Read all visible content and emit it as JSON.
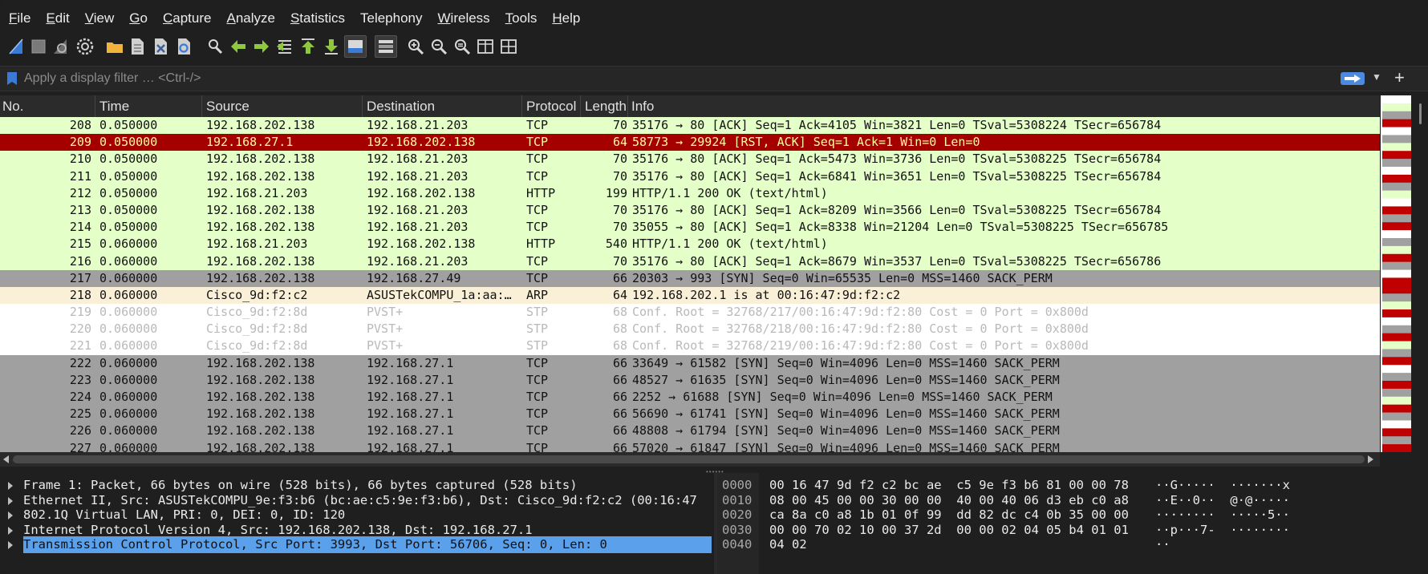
{
  "menu": [
    {
      "ul": "F",
      "rest": "ile"
    },
    {
      "ul": "E",
      "rest": "dit"
    },
    {
      "ul": "V",
      "rest": "iew"
    },
    {
      "ul": "G",
      "rest": "o"
    },
    {
      "ul": "C",
      "rest": "apture"
    },
    {
      "ul": "A",
      "rest": "nalyze"
    },
    {
      "ul": "S",
      "rest": "tatistics"
    },
    {
      "ul": "",
      "rest": "Telephony"
    },
    {
      "ul": "W",
      "rest": "ireless"
    },
    {
      "ul": "T",
      "rest": "ools"
    },
    {
      "ul": "H",
      "rest": "elp"
    }
  ],
  "filter": {
    "placeholder": "Apply a display filter … <Ctrl-/>"
  },
  "columns": {
    "no": "No.",
    "time": "Time",
    "source": "Source",
    "destination": "Destination",
    "protocol": "Protocol",
    "length": "Length",
    "info": "Info"
  },
  "packets": [
    {
      "no": "208",
      "time": "0.050000",
      "src": "192.168.202.138",
      "dst": "192.168.21.203",
      "proto": "TCP",
      "len": "70",
      "info": "35176 → 80 [ACK] Seq=1 Ack=4105 Win=3821 Len=0 TSval=5308224 TSecr=656784",
      "color": "tcp"
    },
    {
      "no": "209",
      "time": "0.050000",
      "src": "192.168.27.1",
      "dst": "192.168.202.138",
      "proto": "TCP",
      "len": "64",
      "info": "58773 → 29924 [RST, ACK] Seq=1 Ack=1 Win=0 Len=0",
      "color": "rst"
    },
    {
      "no": "210",
      "time": "0.050000",
      "src": "192.168.202.138",
      "dst": "192.168.21.203",
      "proto": "TCP",
      "len": "70",
      "info": "35176 → 80 [ACK] Seq=1 Ack=5473 Win=3736 Len=0 TSval=5308225 TSecr=656784",
      "color": "tcp"
    },
    {
      "no": "211",
      "time": "0.050000",
      "src": "192.168.202.138",
      "dst": "192.168.21.203",
      "proto": "TCP",
      "len": "70",
      "info": "35176 → 80 [ACK] Seq=1 Ack=6841 Win=3651 Len=0 TSval=5308225 TSecr=656784",
      "color": "tcp"
    },
    {
      "no": "212",
      "time": "0.050000",
      "src": "192.168.21.203",
      "dst": "192.168.202.138",
      "proto": "HTTP",
      "len": "199",
      "info": "HTTP/1.1 200 OK  (text/html)",
      "color": "http"
    },
    {
      "no": "213",
      "time": "0.050000",
      "src": "192.168.202.138",
      "dst": "192.168.21.203",
      "proto": "TCP",
      "len": "70",
      "info": "35176 → 80 [ACK] Seq=1 Ack=8209 Win=3566 Len=0 TSval=5308225 TSecr=656784",
      "color": "tcp"
    },
    {
      "no": "214",
      "time": "0.050000",
      "src": "192.168.202.138",
      "dst": "192.168.21.203",
      "proto": "TCP",
      "len": "70",
      "info": "35055 → 80 [ACK] Seq=1 Ack=8338 Win=21204 Len=0 TSval=5308225 TSecr=656785",
      "color": "tcp"
    },
    {
      "no": "215",
      "time": "0.060000",
      "src": "192.168.21.203",
      "dst": "192.168.202.138",
      "proto": "HTTP",
      "len": "540",
      "info": "HTTP/1.1 200 OK  (text/html)",
      "color": "http"
    },
    {
      "no": "216",
      "time": "0.060000",
      "src": "192.168.202.138",
      "dst": "192.168.21.203",
      "proto": "TCP",
      "len": "70",
      "info": "35176 → 80 [ACK] Seq=1 Ack=8679 Win=3537 Len=0 TSval=5308225 TSecr=656786",
      "color": "tcp"
    },
    {
      "no": "217",
      "time": "0.060000",
      "src": "192.168.202.138",
      "dst": "192.168.27.49",
      "proto": "TCP",
      "len": "66",
      "info": "20303 → 993 [SYN] Seq=0 Win=65535 Len=0 MSS=1460 SACK_PERM",
      "color": "syn"
    },
    {
      "no": "218",
      "time": "0.060000",
      "src": "Cisco_9d:f2:c2",
      "dst": "ASUSTekCOMPU_1a:aa:…",
      "proto": "ARP",
      "len": "64",
      "info": "192.168.202.1 is at 00:16:47:9d:f2:c2",
      "color": "arp"
    },
    {
      "no": "219",
      "time": "0.060000",
      "src": "Cisco_9d:f2:8d",
      "dst": "PVST+",
      "proto": "STP",
      "len": "68",
      "info": "Conf. Root = 32768/217/00:16:47:9d:f2:80  Cost = 0  Port = 0x800d",
      "color": "stp"
    },
    {
      "no": "220",
      "time": "0.060000",
      "src": "Cisco_9d:f2:8d",
      "dst": "PVST+",
      "proto": "STP",
      "len": "68",
      "info": "Conf. Root = 32768/218/00:16:47:9d:f2:80  Cost = 0  Port = 0x800d",
      "color": "stp"
    },
    {
      "no": "221",
      "time": "0.060000",
      "src": "Cisco_9d:f2:8d",
      "dst": "PVST+",
      "proto": "STP",
      "len": "68",
      "info": "Conf. Root = 32768/219/00:16:47:9d:f2:80  Cost = 0  Port = 0x800d",
      "color": "stp"
    },
    {
      "no": "222",
      "time": "0.060000",
      "src": "192.168.202.138",
      "dst": "192.168.27.1",
      "proto": "TCP",
      "len": "66",
      "info": "33649 → 61582 [SYN] Seq=0 Win=4096 Len=0 MSS=1460 SACK_PERM",
      "color": "syn"
    },
    {
      "no": "223",
      "time": "0.060000",
      "src": "192.168.202.138",
      "dst": "192.168.27.1",
      "proto": "TCP",
      "len": "66",
      "info": "48527 → 61635 [SYN] Seq=0 Win=4096 Len=0 MSS=1460 SACK_PERM",
      "color": "syn"
    },
    {
      "no": "224",
      "time": "0.060000",
      "src": "192.168.202.138",
      "dst": "192.168.27.1",
      "proto": "TCP",
      "len": "66",
      "info": "2252 → 61688 [SYN] Seq=0 Win=4096 Len=0 MSS=1460 SACK_PERM",
      "color": "syn"
    },
    {
      "no": "225",
      "time": "0.060000",
      "src": "192.168.202.138",
      "dst": "192.168.27.1",
      "proto": "TCP",
      "len": "66",
      "info": "56690 → 61741 [SYN] Seq=0 Win=4096 Len=0 MSS=1460 SACK_PERM",
      "color": "syn"
    },
    {
      "no": "226",
      "time": "0.060000",
      "src": "192.168.202.138",
      "dst": "192.168.27.1",
      "proto": "TCP",
      "len": "66",
      "info": "48808 → 61794 [SYN] Seq=0 Win=4096 Len=0 MSS=1460 SACK_PERM",
      "color": "syn"
    },
    {
      "no": "227",
      "time": "0.060000",
      "src": "192.168.202.138",
      "dst": "192.168.27.1",
      "proto": "TCP",
      "len": "66",
      "info": "57020 → 61847 [SYN] Seq=0 Win=4096 Len=0 MSS=1460 SACK_PERM",
      "color": "syn"
    }
  ],
  "details": [
    {
      "text": "Frame 1: Packet, 66 bytes on wire (528 bits), 66 bytes captured (528 bits)",
      "selected": false
    },
    {
      "text": "Ethernet II, Src: ASUSTekCOMPU_9e:f3:b6 (bc:ae:c5:9e:f3:b6), Dst: Cisco_9d:f2:c2 (00:16:47",
      "selected": false
    },
    {
      "text": "802.1Q Virtual LAN, PRI: 0, DEI: 0, ID: 120",
      "selected": false
    },
    {
      "text": "Internet Protocol Version 4, Src: 192.168.202.138, Dst: 192.168.27.1",
      "selected": false
    },
    {
      "text": "Transmission Control Protocol, Src Port: 3993, Dst Port: 56706, Seq: 0, Len: 0",
      "selected": true
    }
  ],
  "bytes": [
    {
      "offset": "0000",
      "hex": "00 16 47 9d f2 c2 bc ae  c5 9e f3 b6 81 00 00 78",
      "ascii": "··G·····  ·······x"
    },
    {
      "offset": "0010",
      "hex": "08 00 45 00 00 30 00 00  40 00 40 06 d3 eb c0 a8",
      "ascii": "··E··0··  @·@·····"
    },
    {
      "offset": "0020",
      "hex": "ca 8a c0 a8 1b 01 0f 99  dd 82 dc c4 0b 35 00 00",
      "ascii": "········  ·····5··"
    },
    {
      "offset": "0030",
      "hex": "00 00 70 02 10 00 37 2d  00 00 02 04 05 b4 01 01",
      "ascii": "··p···7-  ········"
    },
    {
      "offset": "0040",
      "hex": "04 02",
      "ascii": "··"
    }
  ],
  "colors": {
    "tcp": "#e4ffc7",
    "rst": "#a40000",
    "syn": "#a0a0a0",
    "arp": "#faf0d7",
    "stp": "#ffffff",
    "selected": "#5ba0ea",
    "accent": "#3b7bd8"
  },
  "minimap": [
    "#ffffff",
    "#e4ffc7",
    "#a0a0a0",
    "#c00000",
    "#ffffff",
    "#a0a0a0",
    "#e4ffc7",
    "#c00000",
    "#a0a0a0",
    "#ffffff",
    "#c00000",
    "#a0a0a0",
    "#e4ffc7",
    "#ffffff",
    "#c00000",
    "#a0a0a0",
    "#c00000",
    "#ffffff",
    "#a0a0a0",
    "#e4ffc7",
    "#c00000",
    "#a0a0a0",
    "#ffffff",
    "#c00000",
    "#c00000",
    "#a0a0a0",
    "#e4ffc7",
    "#c00000",
    "#ffffff",
    "#a0a0a0",
    "#c00000",
    "#e4ffc7",
    "#a0a0a0",
    "#c00000",
    "#ffffff",
    "#a0a0a0",
    "#c00000",
    "#a0a0a0",
    "#e4ffc7",
    "#c00000",
    "#a0a0a0",
    "#ffffff",
    "#c00000",
    "#a0a0a0",
    "#c00000"
  ],
  "toolbar_icons": [
    "shark-fin-start-icon",
    "stop-square-icon",
    "restart-fin-icon",
    "capture-options-gear-icon",
    "open-folder-icon",
    "save-file-icon",
    "close-file-icon",
    "reload-file-icon",
    "find-packet-icon",
    "go-back-arrow-icon",
    "go-forward-arrow-icon",
    "go-to-packet-icon",
    "go-first-packet-icon",
    "go-last-packet-icon",
    "auto-scroll-icon",
    "colorize-icon",
    "zoom-in-icon",
    "zoom-out-icon",
    "zoom-reset-icon",
    "resize-columns-icon",
    "layout-panes-icon"
  ]
}
